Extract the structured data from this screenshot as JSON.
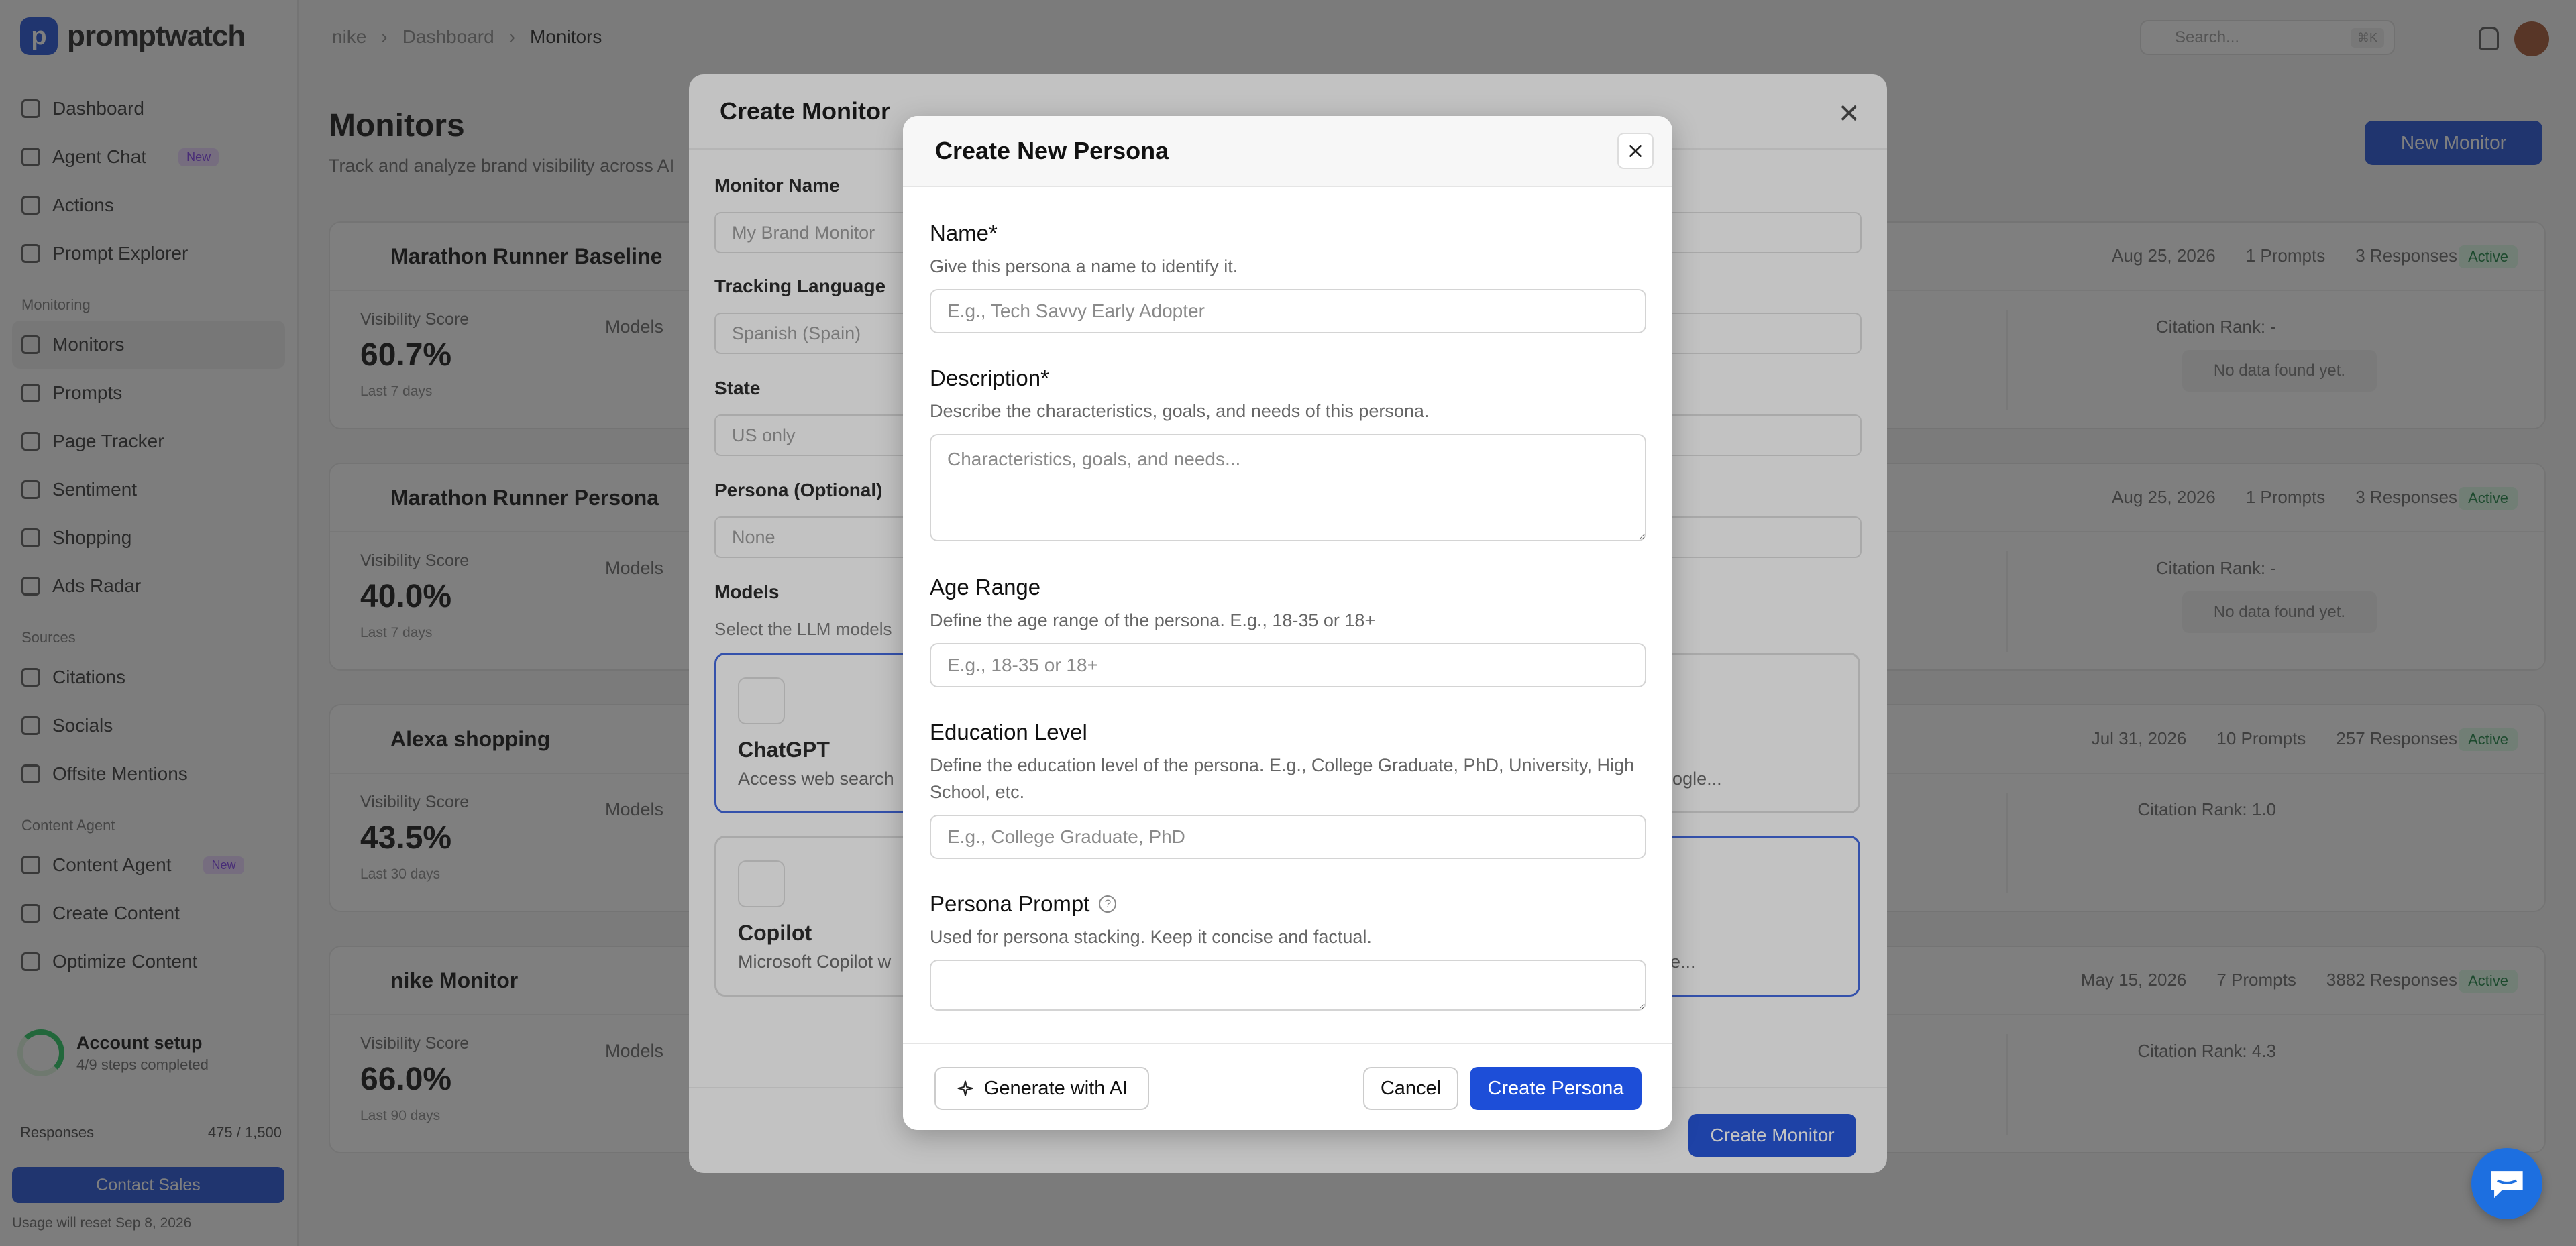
{
  "app": {
    "logo_letter": "p",
    "logo_text": "promptwatch"
  },
  "sidebar": {
    "items": [
      {
        "label": "Dashboard"
      },
      {
        "label": "Agent Chat",
        "badge": "New"
      },
      {
        "label": "Actions"
      },
      {
        "label": "Prompt Explorer"
      }
    ],
    "section_monitoring": "Monitoring",
    "monitoring_items": [
      {
        "label": "Monitors"
      },
      {
        "label": "Prompts"
      },
      {
        "label": "Page Tracker"
      },
      {
        "label": "Sentiment"
      },
      {
        "label": "Shopping"
      },
      {
        "label": "Ads Radar"
      }
    ],
    "section_sources": "Sources",
    "sources_items": [
      {
        "label": "Citations"
      },
      {
        "label": "Socials"
      },
      {
        "label": "Offsite Mentions"
      }
    ],
    "section_content": "Content Agent",
    "content_items": [
      {
        "label": "Content Agent",
        "badge": "New"
      },
      {
        "label": "Create Content"
      },
      {
        "label": "Optimize Content"
      }
    ],
    "account_title": "Account setup",
    "account_sub": "4/9 steps completed",
    "usage_label": "Responses",
    "usage_value": "475 / 1,500",
    "contact_label": "Contact Sales",
    "reset_text": "Usage will reset Sep 8, 2026"
  },
  "topbar": {
    "breadcrumb": [
      "nike",
      "Dashboard",
      "Monitors"
    ],
    "search_placeholder": "Search...",
    "search_kbd": "⌘K"
  },
  "page": {
    "title": "Monitors",
    "subtitle": "Track and analyze brand visibility across AI",
    "new_monitor": "New Monitor"
  },
  "monitors": [
    {
      "name": "Marathon Runner Baseline",
      "date": "Aug 25, 2026",
      "prompts": "1 Prompts",
      "responses": "3 Responses",
      "status": "Active",
      "vis_label": "Visibility Score",
      "score": "60.7%",
      "period": "Last 7 days",
      "models_label": "Models",
      "cite": "Citation Rank: -",
      "no_data": "No data found yet."
    },
    {
      "name": "Marathon Runner Persona",
      "date": "Aug 25, 2026",
      "prompts": "1 Prompts",
      "responses": "3 Responses",
      "status": "Active",
      "vis_label": "Visibility Score",
      "score": "40.0%",
      "period": "Last 7 days",
      "models_label": "Models",
      "cite": "Citation Rank: -",
      "no_data": "No data found yet."
    },
    {
      "name": "Alexa shopping",
      "date": "Jul 31, 2026",
      "prompts": "10 Prompts",
      "responses": "257 Responses",
      "status": "Active",
      "vis_label": "Visibility Score",
      "score": "43.5%",
      "period": "Last 30 days",
      "models_label": "Models",
      "cite": "Citation Rank: 1.0",
      "no_data": ""
    },
    {
      "name": "nike Monitor",
      "date": "May 15, 2026",
      "prompts": "7 Prompts",
      "responses": "3882 Responses",
      "status": "Active",
      "vis_label": "Visibility Score",
      "score": "66.0%",
      "period": "Last 90 days",
      "models_label": "Models",
      "cite": "Citation Rank: 4.3",
      "no_data": ""
    }
  ],
  "create_monitor": {
    "title": "Create Monitor",
    "name_label": "Monitor Name",
    "name_placeholder": "My Brand Monitor",
    "lang_label": "Tracking Language",
    "lang_value": "Spanish (Spain)",
    "state_label": "State",
    "state_value": "US only",
    "persona_label": "Persona (Optional)",
    "persona_value": "None",
    "models_label": "Models",
    "models_hint": "Select the LLM models",
    "model_cards": [
      {
        "name": "ChatGPT",
        "desc": "Access web search"
      },
      {
        "name": "Copilot",
        "desc": "Microsoft Copilot w"
      }
    ],
    "side_desc_1": "side Google...",
    "side_desc_2": "real-time...",
    "create_label": "Create Monitor"
  },
  "persona_modal": {
    "title": "Create New Persona",
    "fields": {
      "name": {
        "label": "Name*",
        "hint": "Give this persona a name to identify it.",
        "placeholder": "E.g., Tech Savvy Early Adopter",
        "value": ""
      },
      "description": {
        "label": "Description*",
        "hint": "Describe the characteristics, goals, and needs of this persona.",
        "placeholder": "Characteristics, goals, and needs...",
        "value": ""
      },
      "age": {
        "label": "Age Range",
        "hint": "Define the age range of the persona. E.g., 18-35 or 18+",
        "placeholder": "E.g., 18-35 or 18+",
        "value": ""
      },
      "education": {
        "label": "Education Level",
        "hint": "Define the education level of the persona. E.g., College Graduate, PhD, University, High School, etc.",
        "placeholder": "E.g., College Graduate, PhD",
        "value": ""
      },
      "prompt": {
        "label": "Persona Prompt",
        "help": "?",
        "hint": "Used for persona stacking. Keep it concise and factual.",
        "placeholder": "",
        "value": ""
      }
    },
    "generate_label": "Generate with AI",
    "cancel_label": "Cancel",
    "create_label": "Create Persona"
  },
  "colors": {
    "primary": "#1d4ed8",
    "active_green": "#15803d",
    "badge_purple": "#7c3aed"
  },
  "icons": {
    "close": "close-icon",
    "sparkle": "sparkle-icon",
    "help": "help-circle-icon",
    "chat": "chat-bubble-icon"
  }
}
